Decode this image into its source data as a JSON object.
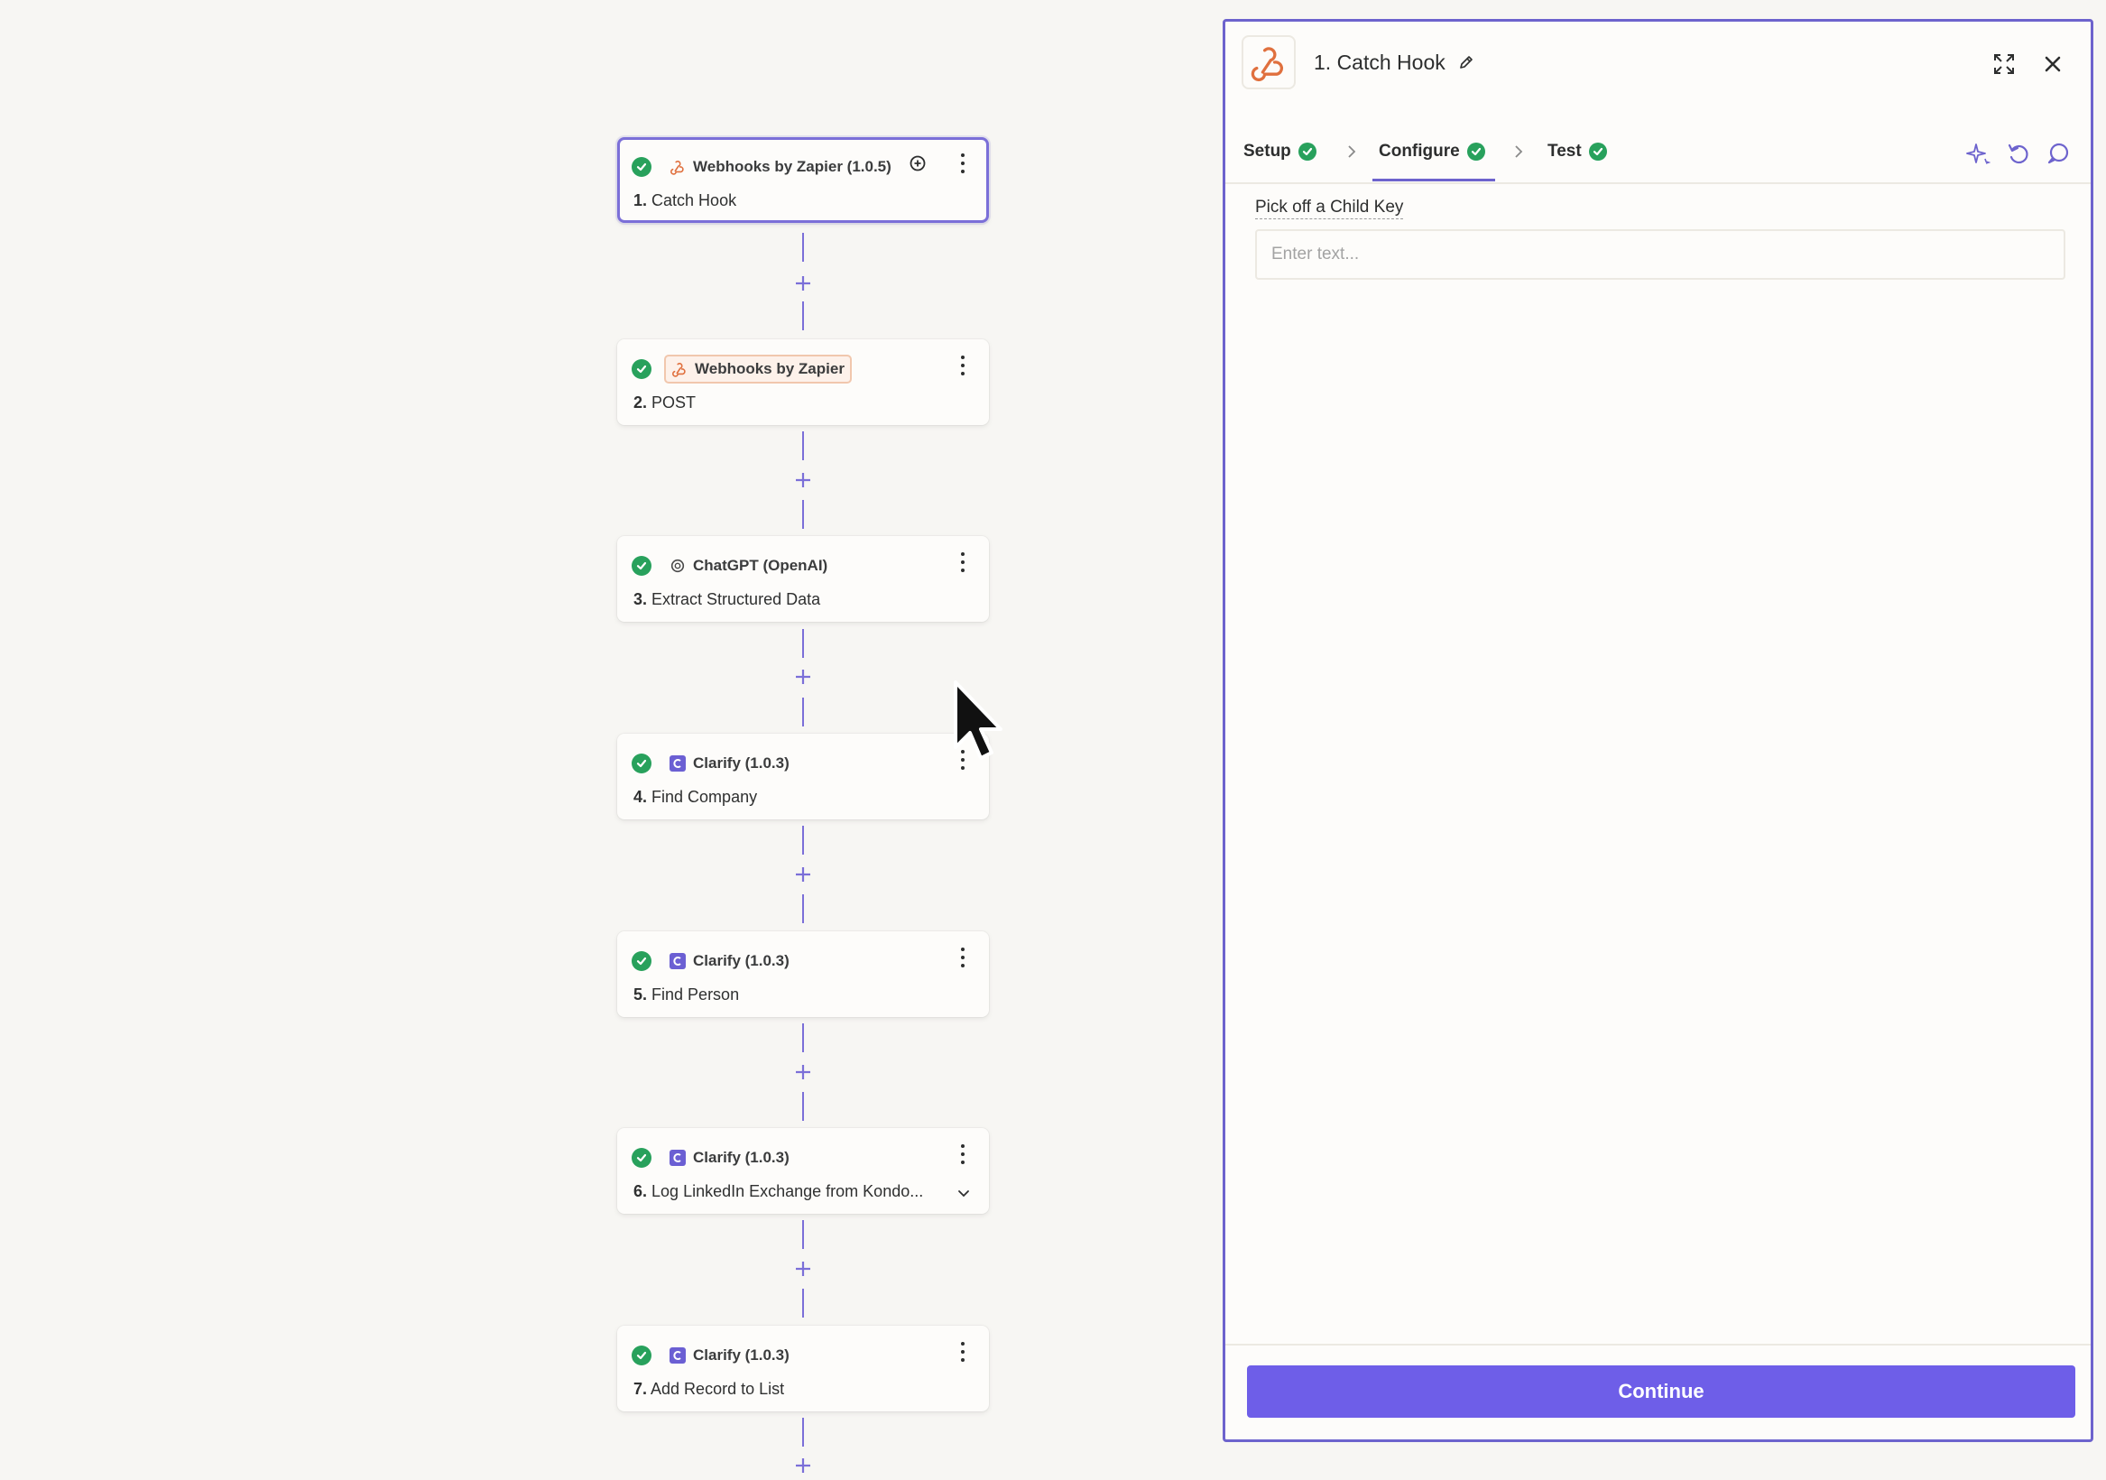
{
  "steps": [
    {
      "app": "Webhooks by Zapier (1.0.5)",
      "num": "1.",
      "title": "Catch Hook",
      "icon": "webhook-icon"
    },
    {
      "app": "Webhooks by Zapier",
      "num": "2.",
      "title": "POST",
      "icon": "webhook-icon"
    },
    {
      "app": "ChatGPT (OpenAI)",
      "num": "3.",
      "title": "Extract Structured Data",
      "icon": "openai-icon"
    },
    {
      "app": "Clarify (1.0.3)",
      "num": "4.",
      "title": "Find Company",
      "icon": "clarify-icon"
    },
    {
      "app": "Clarify (1.0.3)",
      "num": "5.",
      "title": "Find Person",
      "icon": "clarify-icon"
    },
    {
      "app": "Clarify (1.0.3)",
      "num": "6.",
      "title": "Log LinkedIn Exchange from Kondo...",
      "icon": "clarify-icon"
    },
    {
      "app": "Clarify (1.0.3)",
      "num": "7.",
      "title": "Add Record to List",
      "icon": "clarify-icon"
    }
  ],
  "panel": {
    "title": "1. Catch Hook",
    "tabs": [
      {
        "label": "Setup"
      },
      {
        "label": "Configure"
      },
      {
        "label": "Test"
      }
    ],
    "field": {
      "label": "Pick off a Child Key",
      "placeholder": "Enter text...",
      "value": ""
    },
    "continue_label": "Continue"
  },
  "colors": {
    "accent": "#6d63cd",
    "button": "#6e5ee8",
    "success": "#28a15c",
    "webhook_orange": "#e0703e",
    "clarify_purple": "#6b5fd3"
  }
}
